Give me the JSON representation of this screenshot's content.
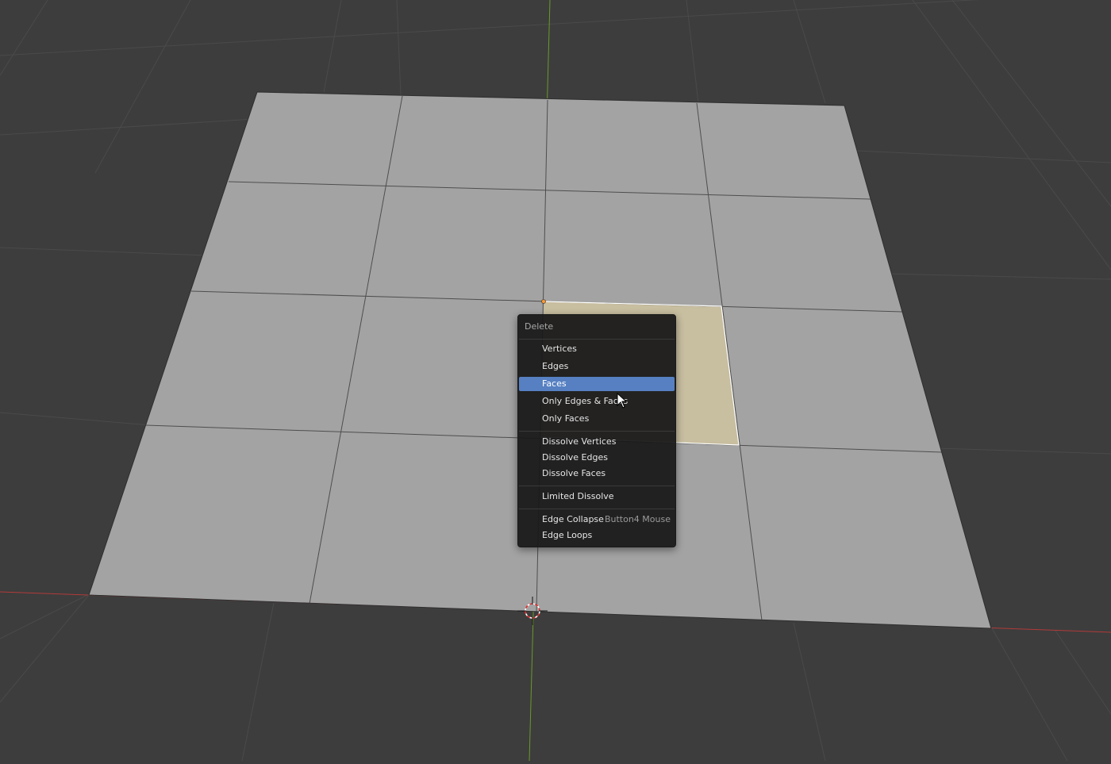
{
  "viewport": {
    "background_color": "#3d3d3d",
    "mesh_face_color": "#a3a3a3",
    "selected_face_color": "#c8bea0",
    "x_axis_color": "#b23a3a",
    "y_axis_color": "#6a9a2a"
  },
  "delete_menu": {
    "title": "Delete",
    "items": [
      {
        "label": "Vertices"
      },
      {
        "label": "Edges"
      },
      {
        "label": "Faces",
        "active": true
      },
      {
        "label": "Only Edges & Faces"
      },
      {
        "label": "Only Faces"
      },
      {
        "label": "Dissolve Vertices"
      },
      {
        "label": "Dissolve Edges"
      },
      {
        "label": "Dissolve Faces"
      },
      {
        "label": "Limited Dissolve"
      },
      {
        "label": "Edge Collapse",
        "shortcut": "Button4 Mouse"
      },
      {
        "label": "Edge Loops"
      }
    ]
  }
}
